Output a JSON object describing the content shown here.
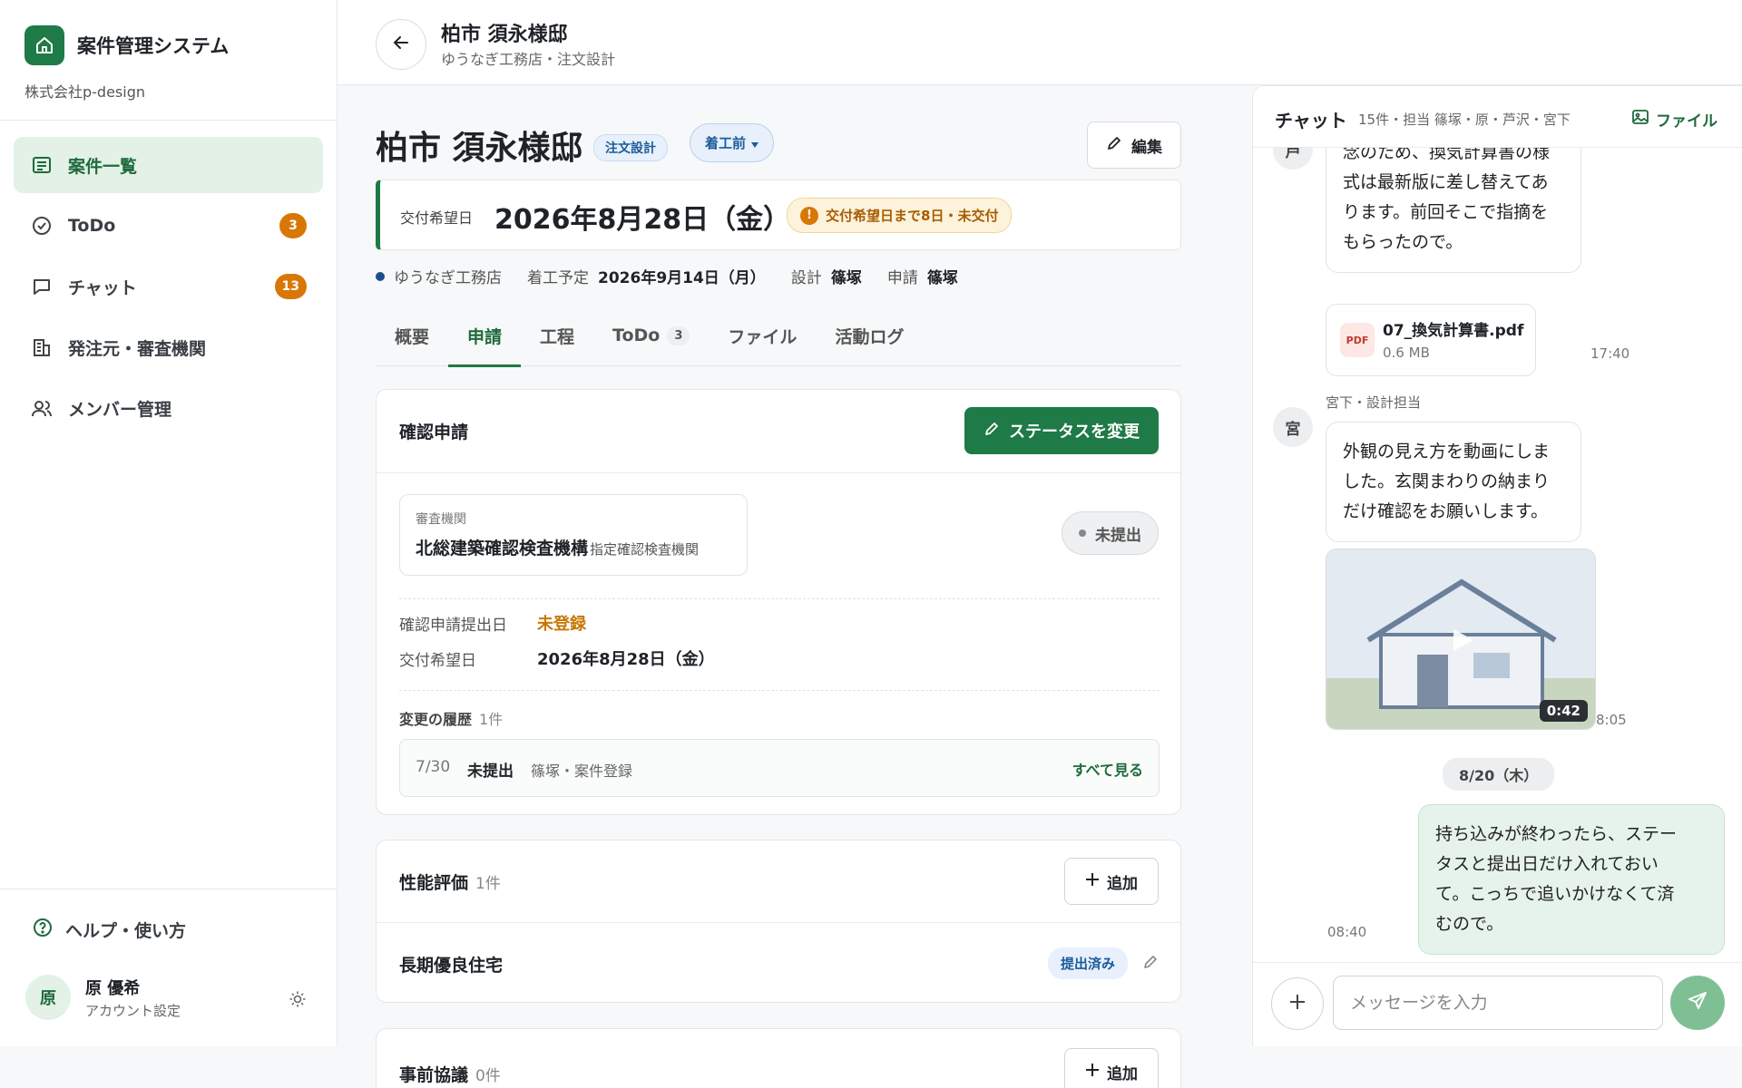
{
  "app": {
    "title": "案件管理システム",
    "company": "株式会社p-design"
  },
  "sidebar": {
    "items": [
      {
        "label": "案件一覧",
        "icon": "list-icon",
        "active": true
      },
      {
        "label": "ToDo",
        "icon": "check-circle-icon",
        "badge": "3"
      },
      {
        "label": "チャット",
        "icon": "chat-bubble-icon",
        "badge": "13"
      },
      {
        "label": "発注元・審査機関",
        "icon": "building-icon"
      },
      {
        "label": "メンバー管理",
        "icon": "users-icon"
      }
    ],
    "help_label": "ヘルプ・使い方",
    "user": {
      "avatar": "原",
      "name": "原 優希",
      "sub": "アカウント設定"
    }
  },
  "header": {
    "title": "柏市 須永様邸",
    "subtitle": "ゆうなぎ工務店・注文設計"
  },
  "project": {
    "title": "柏市 須永様邸",
    "type_tag": "注文設計",
    "status": "着工前",
    "edit_label": "編集",
    "due": {
      "label": "交付希望日",
      "date": "2026年8月28日（金）",
      "warning": "交付希望日まで8日・未交付"
    },
    "meta": {
      "client": "ゆうなぎ工務店",
      "start_label": "着工予定",
      "start_value": "2026年9月14日（月）",
      "design_label": "設計",
      "design_value": "篠塚",
      "apply_label": "申請",
      "apply_value": "篠塚"
    },
    "tabs": [
      {
        "label": "概要"
      },
      {
        "label": "申請",
        "active": true
      },
      {
        "label": "工程"
      },
      {
        "label": "ToDo",
        "count": "3"
      },
      {
        "label": "ファイル"
      },
      {
        "label": "活動ログ"
      }
    ]
  },
  "confirm": {
    "title": "確認申請",
    "change_status_label": "ステータスを変更",
    "agency_label": "審査機関",
    "agency_name": "北総建築確認検査機構",
    "agency_kind": "指定確認検査機関",
    "status": "未提出",
    "submit_label": "確認申請提出日",
    "submit_value": "未登録",
    "due_label": "交付希望日",
    "due_value": "2026年8月28日（金）",
    "history_title": "変更の履歴",
    "history_count": "1件",
    "history_row": {
      "date": "7/30",
      "status": "未提出",
      "by": "篠塚・案件登録"
    },
    "history_all": "すべて見る"
  },
  "performance": {
    "title": "性能評価",
    "count": "1件",
    "add_label": "追加",
    "item_name": "長期優良住宅",
    "item_badge": "提出済み"
  },
  "prior": {
    "title": "事前協議",
    "count": "0件",
    "add_label": "追加"
  },
  "chat": {
    "title": "チャット",
    "meta": "15件・担当 篠塚・原・芦沢・宮下",
    "file_label": "ファイル",
    "msg1": {
      "avatar": "芦",
      "lines": [
        "念のため、換気計算書の様",
        "式は最新版に差し替えてあ",
        "ります。前回そこで指摘を",
        "もらったので。"
      ]
    },
    "file": {
      "icon": "PDF",
      "name": "07_換気計算書.pdf",
      "size": "0.6 MB",
      "time": "17:40"
    },
    "msg2": {
      "sender": "宮下・設計担当",
      "avatar": "宮",
      "lines": [
        "外観の見え方を動画にしま",
        "した。玄関まわりの納まり",
        "だけ確認をお願いします。"
      ]
    },
    "video": {
      "duration": "0:42",
      "time": "8:05"
    },
    "date_separator": "8/20（木）",
    "msg3": {
      "lines": [
        "持ち込みが終わったら、ステー",
        "タスと提出日だけ入れておい",
        "て。こっちで追いかけなくて済",
        "むので。"
      ],
      "time": "08:40"
    },
    "input_placeholder": "メッセージを入力"
  },
  "colors": {
    "brand": "#1e7a46",
    "warning": "#d97706",
    "info": "#1c5b9a"
  }
}
